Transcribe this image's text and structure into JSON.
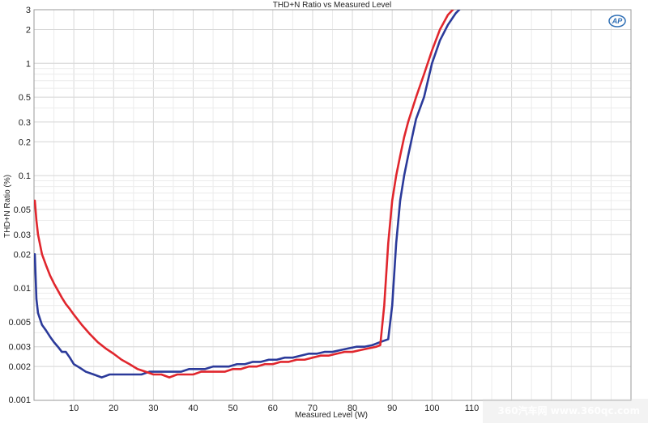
{
  "chart_data": {
    "type": "line",
    "title": "THD+N Ratio vs Measured Level",
    "xlabel": "Measured Level (W)",
    "ylabel": "THD+N Ratio (%)",
    "xlim": [
      0,
      150
    ],
    "ylim": [
      0.001,
      3
    ],
    "yscale": "log",
    "grid": true,
    "x_ticks": [
      10,
      20,
      30,
      40,
      50,
      60,
      70,
      80,
      90,
      100,
      110,
      120,
      130,
      140,
      150
    ],
    "x_tick_labels": [
      "10",
      "20",
      "30",
      "40",
      "50",
      "60",
      "70",
      "80",
      "90",
      "100",
      "110",
      "",
      "",
      "",
      ""
    ],
    "y_ticks": [
      0.001,
      0.002,
      0.003,
      0.005,
      0.01,
      0.02,
      0.03,
      0.05,
      0.1,
      0.2,
      0.3,
      0.5,
      1,
      2,
      3
    ],
    "y_tick_labels": [
      "0.001",
      "0.002",
      "0.003",
      "0.005",
      "0.01",
      "0.02",
      "0.03",
      "0.05",
      "0.1",
      "0.2",
      "0.3",
      "0.5",
      "1",
      "2",
      "3"
    ],
    "series": [
      {
        "color": "#2b3a9a",
        "x": [
          0.2,
          0.6,
          1,
          2,
          3,
          4,
          5,
          6,
          7,
          8,
          9,
          10,
          11,
          12,
          13,
          15,
          17,
          19,
          21,
          23,
          25,
          27,
          29,
          31,
          33,
          35,
          37,
          39,
          41,
          43,
          45,
          47,
          49,
          51,
          53,
          55,
          57,
          59,
          61,
          63,
          65,
          67,
          69,
          71,
          73,
          75,
          77,
          79,
          81,
          83,
          85,
          87,
          88,
          89,
          90,
          91,
          92,
          93,
          94,
          95,
          96,
          98,
          100,
          102,
          104,
          106,
          108,
          109
        ],
        "y": [
          0.02,
          0.008,
          0.006,
          0.0047,
          0.0042,
          0.0037,
          0.0033,
          0.003,
          0.0027,
          0.0027,
          0.0024,
          0.0021,
          0.002,
          0.0019,
          0.0018,
          0.0017,
          0.0016,
          0.0017,
          0.0017,
          0.0017,
          0.0017,
          0.0017,
          0.0018,
          0.0018,
          0.0018,
          0.0018,
          0.0018,
          0.0019,
          0.0019,
          0.0019,
          0.002,
          0.002,
          0.002,
          0.0021,
          0.0021,
          0.0022,
          0.0022,
          0.0023,
          0.0023,
          0.0024,
          0.0024,
          0.0025,
          0.0026,
          0.0026,
          0.0027,
          0.0027,
          0.0028,
          0.0029,
          0.003,
          0.003,
          0.0031,
          0.0033,
          0.0034,
          0.0035,
          0.007,
          0.025,
          0.06,
          0.1,
          0.15,
          0.22,
          0.32,
          0.5,
          1.0,
          1.6,
          2.2,
          2.8,
          3.3,
          3.6
        ]
      },
      {
        "color": "#e0262d",
        "x": [
          0.2,
          0.6,
          1,
          2,
          3,
          4,
          5,
          6,
          7,
          8,
          9,
          10,
          12,
          14,
          16,
          18,
          20,
          22,
          24,
          26,
          28,
          30,
          32,
          34,
          36,
          38,
          40,
          42,
          44,
          46,
          48,
          50,
          52,
          54,
          56,
          58,
          60,
          62,
          64,
          66,
          68,
          70,
          72,
          74,
          76,
          78,
          80,
          82,
          84,
          86,
          87,
          88,
          89,
          90,
          91,
          92,
          93,
          94,
          96,
          98,
          100,
          102,
          104,
          106,
          107
        ],
        "y": [
          0.06,
          0.04,
          0.03,
          0.02,
          0.016,
          0.013,
          0.011,
          0.0095,
          0.0082,
          0.0072,
          0.0065,
          0.0058,
          0.0047,
          0.0039,
          0.0033,
          0.0029,
          0.0026,
          0.0023,
          0.0021,
          0.0019,
          0.0018,
          0.0017,
          0.0017,
          0.0016,
          0.0017,
          0.0017,
          0.0017,
          0.0018,
          0.0018,
          0.0018,
          0.0018,
          0.0019,
          0.0019,
          0.002,
          0.002,
          0.0021,
          0.0021,
          0.0022,
          0.0022,
          0.0023,
          0.0023,
          0.0024,
          0.0025,
          0.0025,
          0.0026,
          0.0027,
          0.0027,
          0.0028,
          0.0029,
          0.003,
          0.0031,
          0.007,
          0.025,
          0.06,
          0.1,
          0.15,
          0.22,
          0.3,
          0.5,
          0.8,
          1.3,
          2.0,
          2.7,
          3.2,
          3.4
        ]
      }
    ]
  },
  "watermark": {
    "logo": "AP",
    "site": "360汽车网 www.360qc.com"
  }
}
